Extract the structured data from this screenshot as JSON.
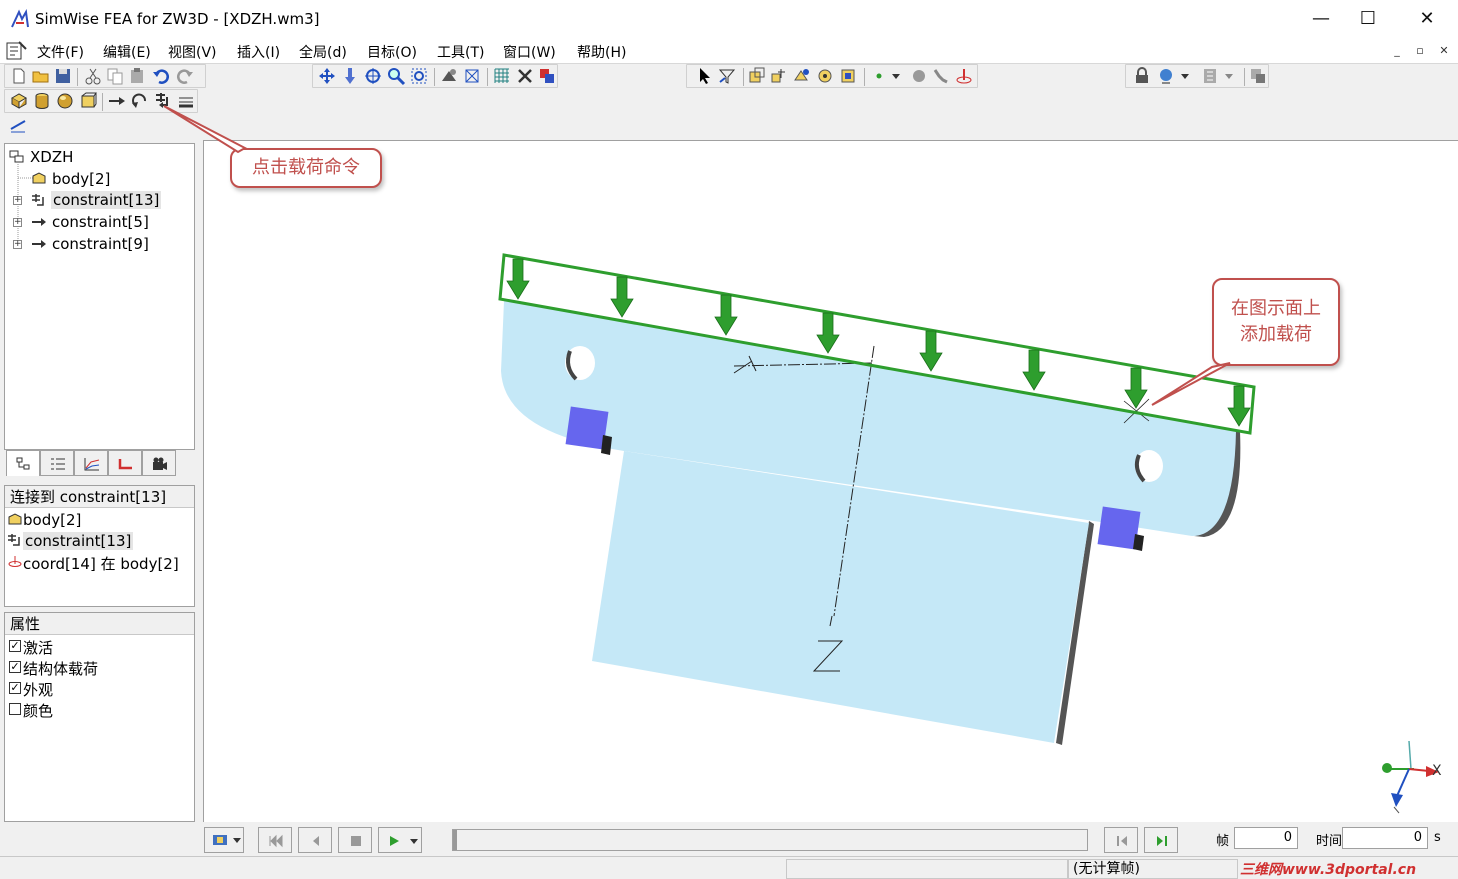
{
  "window": {
    "title": "SimWise FEA for ZW3D - [XDZH.wm3]",
    "minimize": "—",
    "maximize": "☐",
    "close": "✕"
  },
  "menu": {
    "items": [
      "文件(F)",
      "编辑(E)",
      "视图(V)",
      "插入(I)",
      "全局(d)",
      "目标(O)",
      "工具(T)",
      "窗口(W)",
      "帮助(H)"
    ]
  },
  "tree": {
    "root": "XDZH",
    "items": [
      "body[2]",
      "constraint[13]",
      "constraint[5]",
      "constraint[9]"
    ]
  },
  "connection_panel": {
    "header": "连接到 constraint[13]",
    "items": [
      "body[2]",
      "constraint[13]",
      "coord[14] 在 body[2]"
    ]
  },
  "properties": {
    "header": "属性",
    "items": [
      {
        "label": "激活",
        "checked": true
      },
      {
        "label": "结构体载荷",
        "checked": true
      },
      {
        "label": "外观",
        "checked": true
      },
      {
        "label": "颜色",
        "checked": false
      }
    ]
  },
  "callouts": {
    "load_command": "点击载荷命令",
    "add_load_line1": "在图示面上",
    "add_load_line2": "添加载荷"
  },
  "viewport": {
    "axis_y": "Y",
    "axis_z": "Z",
    "axis_x": "X"
  },
  "playback": {
    "frame_label": "帧",
    "frame_value": "0",
    "time_label": "时间",
    "time_value": "0",
    "time_unit": "s"
  },
  "status": {
    "text": "(无计算帧)",
    "watermark": "三维网www.3dportal.cn"
  },
  "colors": {
    "accent_red": "#c0504d",
    "part_fill": "#c5e8f7",
    "load_green": "#2e9e2e",
    "constraint_blue": "#6666ee"
  }
}
